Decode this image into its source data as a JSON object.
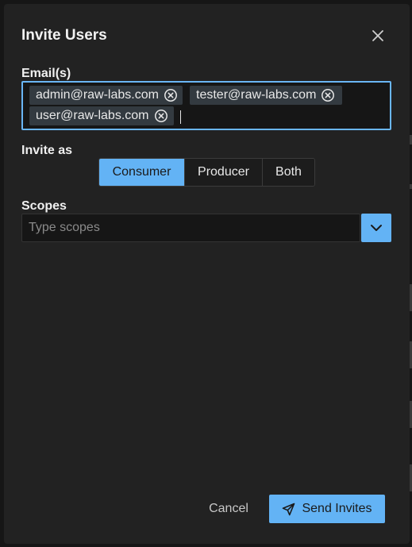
{
  "dialog": {
    "title": "Invite Users",
    "close_icon": "close-icon"
  },
  "emails": {
    "label": "Email(s)",
    "chips": [
      {
        "text": "admin@raw-labs.com",
        "remove_icon": "remove-circle-icon"
      },
      {
        "text": "tester@raw-labs.com",
        "remove_icon": "remove-circle-icon"
      },
      {
        "text": "user@raw-labs.com",
        "remove_icon": "remove-circle-icon"
      }
    ],
    "input_value": ""
  },
  "invite_as": {
    "label": "Invite as",
    "options": [
      "Consumer",
      "Producer",
      "Both"
    ],
    "selected": "Consumer"
  },
  "scopes": {
    "label": "Scopes",
    "placeholder": "Type scopes",
    "toggle_icon": "chevron-down-icon"
  },
  "footer": {
    "cancel_label": "Cancel",
    "send_label": "Send Invites",
    "send_icon": "send-icon"
  },
  "colors": {
    "accent": "#63b3f5",
    "dialog_bg": "#222222",
    "input_bg": "#161616",
    "chip_bg": "#333a40",
    "focus_border": "#6ab6f5"
  }
}
